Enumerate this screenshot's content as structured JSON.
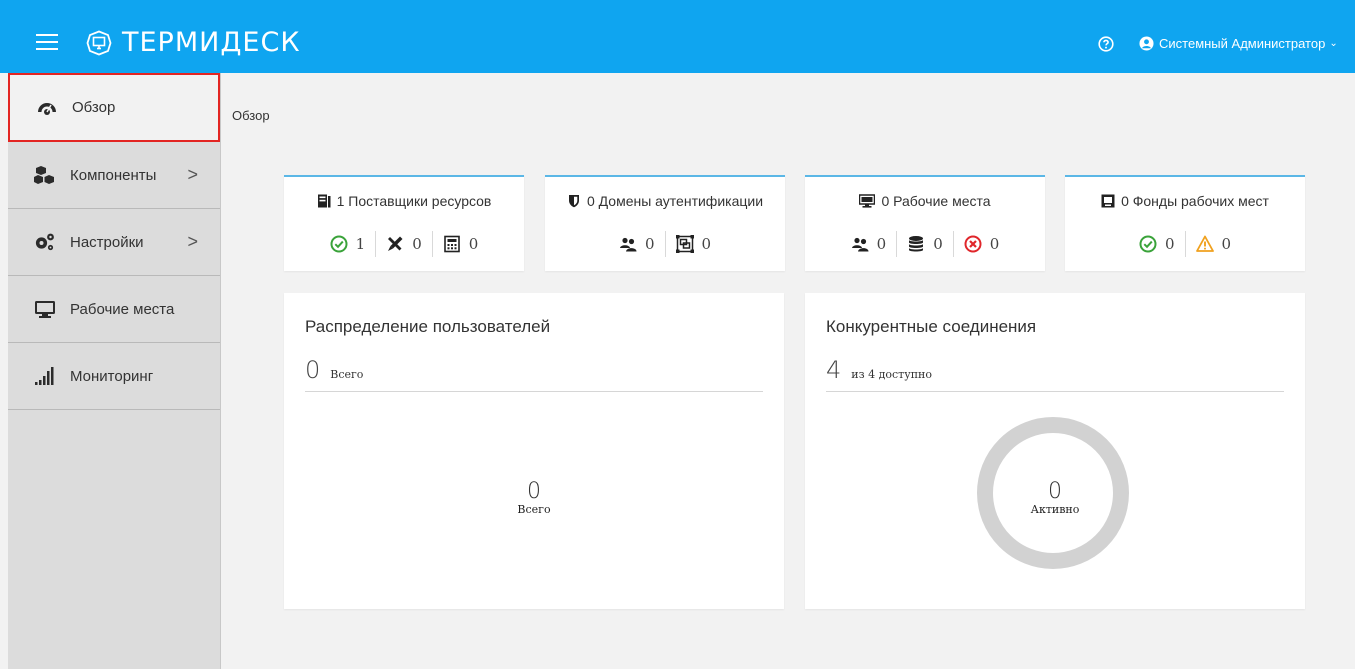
{
  "header": {
    "brand": "ТЕРМИДЕСК",
    "user_name": "Системный Администратор",
    "bg_color": "#0fa5f0"
  },
  "sidebar": {
    "items": [
      {
        "label": "Обзор",
        "icon": "dashboard-gauge-icon",
        "active": true
      },
      {
        "label": "Компоненты",
        "icon": "cubes-icon",
        "has_children": true
      },
      {
        "label": "Настройки",
        "icon": "gears-icon",
        "has_children": true
      },
      {
        "label": "Рабочие места",
        "icon": "monitor-icon"
      },
      {
        "label": "Мониторинг",
        "icon": "signal-bars-icon"
      }
    ]
  },
  "breadcrumb": "Обзор",
  "stat_cards": [
    {
      "title": "1 Поставщики ресурсов",
      "icon": "server-icon",
      "stats": [
        {
          "icon": "check-circle-icon",
          "value": "1",
          "color": "#3aa33a"
        },
        {
          "icon": "tools-icon",
          "value": "0",
          "color": "#333333"
        },
        {
          "icon": "calculator-icon",
          "value": "0",
          "color": "#333333"
        }
      ]
    },
    {
      "title": "0 Домены аутентификации",
      "icon": "shield-icon",
      "stats": [
        {
          "icon": "users-icon",
          "value": "0",
          "color": "#333333"
        },
        {
          "icon": "object-group-icon",
          "value": "0",
          "color": "#333333"
        }
      ]
    },
    {
      "title": "0 Рабочие места",
      "icon": "desktop-icon",
      "stats": [
        {
          "icon": "users-icon",
          "value": "0",
          "color": "#333333"
        },
        {
          "icon": "database-icon",
          "value": "0",
          "color": "#333333"
        },
        {
          "icon": "error-circle-icon",
          "value": "0",
          "color": "#e0262b"
        }
      ]
    },
    {
      "title": "0 Фонды рабочих мест",
      "icon": "pool-icon",
      "stats": [
        {
          "icon": "check-circle-icon",
          "value": "0",
          "color": "#3aa33a"
        },
        {
          "icon": "warning-icon",
          "value": "0",
          "color": "#f0a11e"
        }
      ]
    }
  ],
  "users_panel": {
    "title": "Распределение пользователей",
    "total": "0",
    "total_label": "Всего",
    "center_value": "0",
    "center_label": "Всего"
  },
  "connections_panel": {
    "title": "Конкурентные соединения",
    "value": "4",
    "value_label": "из 4 доступно",
    "center_value": "0",
    "center_label": "Активно"
  }
}
